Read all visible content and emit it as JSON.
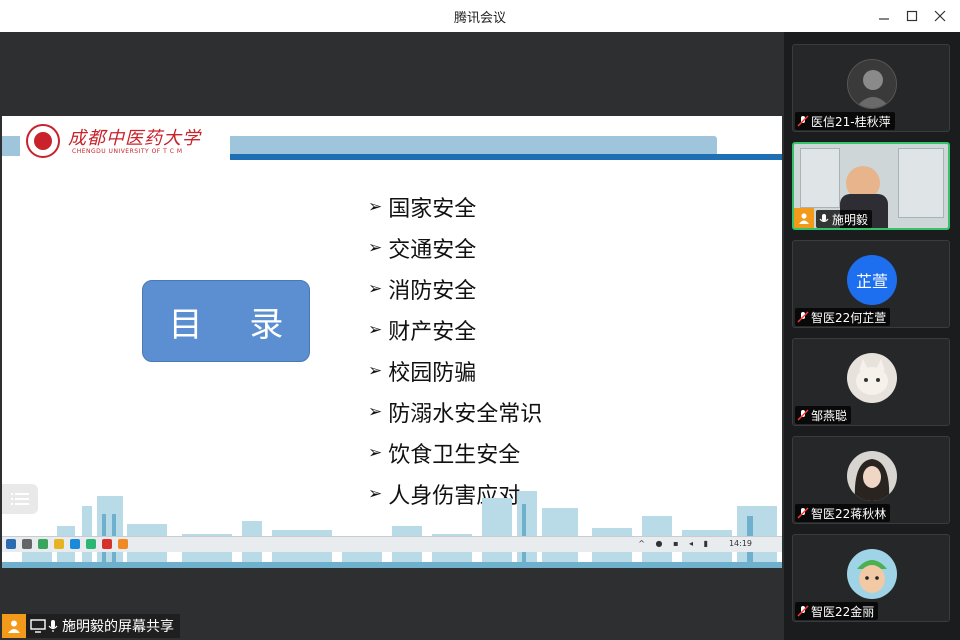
{
  "window": {
    "title": "腾讯会议"
  },
  "slide": {
    "logo_cn": "成都中医药大学",
    "logo_en": "CHENGDU UNIVERSITY OF T C M",
    "toc_title": "目 录",
    "items": [
      "国家安全",
      "交通安全",
      "消防安全",
      "财产安全",
      "校园防骗",
      "防溺水安全常识",
      "饮食卫生安全",
      "人身伤害应对"
    ]
  },
  "taskbar": {
    "clock": "14:19"
  },
  "share_label": "施明毅的屏幕共享",
  "participants": [
    {
      "name": "医信21-桂秋萍",
      "avatar": "photo-portrait",
      "mic": "muted"
    },
    {
      "name": "施明毅",
      "avatar": "video-feed",
      "mic": "on",
      "active": true
    },
    {
      "name": "智医22何芷萱",
      "avatar_text": "芷萱",
      "mic": "muted"
    },
    {
      "name": "邹燕聪",
      "avatar": "cat-photo",
      "mic": "muted"
    },
    {
      "name": "智医22蒋秋林",
      "avatar": "girl-photo",
      "mic": "muted"
    },
    {
      "name": "智医22金丽",
      "avatar": "cartoon-photo",
      "mic": "muted"
    }
  ],
  "colors": {
    "accent_green": "#35c36a",
    "brand_red": "#c9222b",
    "toc_blue": "#5b8fd1",
    "header_blue": "#1f6fb5"
  }
}
